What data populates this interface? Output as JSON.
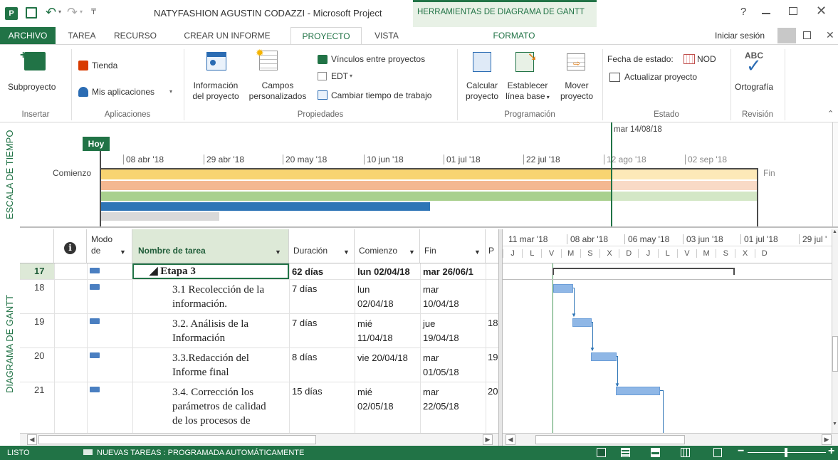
{
  "window": {
    "title": "NATYFASHION AGUSTIN CODAZZI - Microsoft Project",
    "contextual_tab_group": "HERRAMIENTAS DE DIAGRAMA DE GANTT",
    "help": "?",
    "signin": "Iniciar sesión"
  },
  "tabs": [
    "ARCHIVO",
    "TAREA",
    "RECURSO",
    "CREAR UN INFORME",
    "PROYECTO",
    "VISTA",
    "FORMATO"
  ],
  "ribbon": {
    "insertar": {
      "label": "Insertar",
      "subproyecto": "Subproyecto"
    },
    "aplicaciones": {
      "label": "Aplicaciones",
      "tienda": "Tienda",
      "mis_aplicaciones": "Mis aplicaciones"
    },
    "propiedades": {
      "label": "Propiedades",
      "info_line1": "Información",
      "info_line2": "del proyecto",
      "campos_line1": "Campos",
      "campos_line2": "personalizados",
      "vinculos": "Vínculos entre proyectos",
      "edt": "EDT",
      "cambiar": "Cambiar tiempo de trabajo"
    },
    "programacion": {
      "label": "Programación",
      "calcular_line1": "Calcular",
      "calcular_line2": "proyecto",
      "establecer_line1": "Establecer",
      "establecer_line2": "línea base",
      "mover_line1": "Mover",
      "mover_line2": "proyecto"
    },
    "estado": {
      "label": "Estado",
      "fecha": "Fecha de estado:",
      "fecha_value": "NOD",
      "actualizar": "Actualizar proyecto"
    },
    "revision": {
      "label": "Revisión",
      "abc": "ABC",
      "ortografia": "Ortografía"
    }
  },
  "timeline": {
    "side_label": "ESCALA DE TIEMPO",
    "hoy": "Hoy",
    "status_date": "mar 14/08/18",
    "comienzo": "Comienzo",
    "fin": "Fin",
    "dates": [
      "08 abr '18",
      "29 abr '18",
      "20 may '18",
      "10 jun '18",
      "01 jul '18",
      "22 jul '18",
      "12 ago '18",
      "02 sep '18"
    ]
  },
  "gantt_side_label": "DIAGRAMA DE GANTT",
  "grid": {
    "headers": {
      "modo_line1": "Modo",
      "modo_line2": "de",
      "nombre": "Nombre de tarea",
      "duracion": "Duración",
      "comienzo": "Comienzo",
      "fin": "Fin",
      "pred": "P"
    },
    "rows": [
      {
        "id": "17",
        "name_lines": [
          "◢ Etapa 3"
        ],
        "duration": "62 días",
        "start_lines": [
          "lun 02/04/18"
        ],
        "finish_lines": [
          "mar 26/06/1"
        ],
        "pred": "",
        "summary": true
      },
      {
        "id": "18",
        "name_lines": [
          "3.1 Recolección de la",
          "información."
        ],
        "duration": "7 días",
        "start_lines": [
          "lun",
          "02/04/18"
        ],
        "finish_lines": [
          "mar",
          "10/04/18"
        ],
        "pred": "",
        "summary": false
      },
      {
        "id": "19",
        "name_lines": [
          "3.2. Análisis de la",
          "Información"
        ],
        "duration": "7 días",
        "start_lines": [
          "mié",
          "11/04/18"
        ],
        "finish_lines": [
          "jue",
          "19/04/18"
        ],
        "pred": "18",
        "summary": false
      },
      {
        "id": "20",
        "name_lines": [
          "3.3.Redacción del",
          "Informe final"
        ],
        "duration": "8 días",
        "start_lines": [
          "vie 20/04/18"
        ],
        "finish_lines": [
          "mar",
          "01/05/18"
        ],
        "pred": "19",
        "summary": false
      },
      {
        "id": "21",
        "name_lines": [
          "3.4. Corrección los",
          "parámetros de calidad",
          "de los procesos de"
        ],
        "duration": "15 días",
        "start_lines": [
          "mié",
          "02/05/18"
        ],
        "finish_lines": [
          "mar",
          "22/05/18"
        ],
        "pred": "20",
        "summary": false
      }
    ]
  },
  "gantt_chart": {
    "top_dates": [
      "11 mar '18",
      "08 abr '18",
      "06 may '18",
      "03 jun '18",
      "01 jul '18",
      "29 jul '"
    ],
    "day_letters": [
      "J",
      "L",
      "V",
      "M",
      "S",
      "X",
      "D",
      "J",
      "L",
      "V",
      "M",
      "S",
      "X",
      "D"
    ]
  },
  "status": {
    "ready": "LISTO",
    "new_tasks": "NUEVAS TAREAS : PROGRAMADA AUTOMÁTICAMENTE"
  },
  "colors": {
    "accent": "#217346",
    "timeline_yellow": "#f8d471",
    "timeline_orange": "#f4b891",
    "timeline_green": "#a9d08e",
    "timeline_blue": "#2e75b6",
    "gantt_bar": "#8fb7e6"
  }
}
